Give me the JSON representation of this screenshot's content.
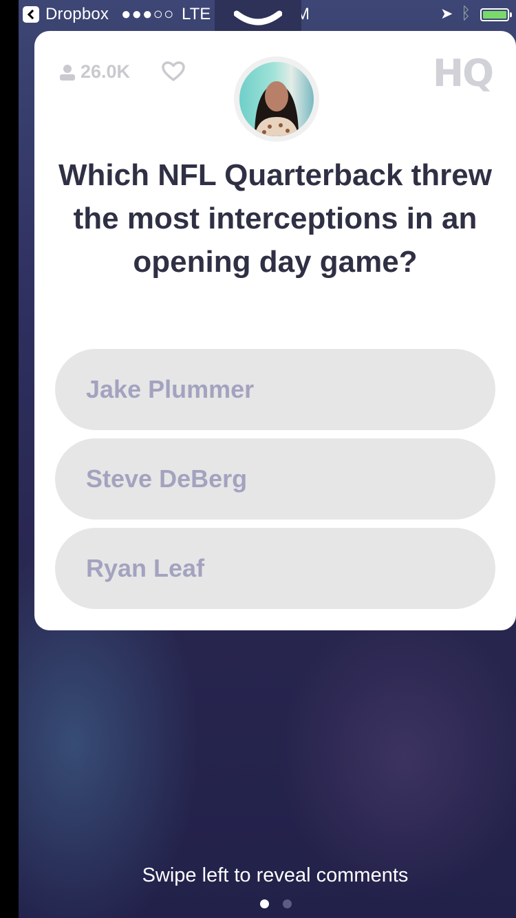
{
  "status_bar": {
    "back_app": "Dropbox",
    "signal": "●●●○○",
    "network": "LTE",
    "time_fragment": "M",
    "battery_level": 1.0
  },
  "game": {
    "viewer_count": "26.0K",
    "logo": "HQ",
    "question": "Which NFL Quarterback threw the most interceptions in an opening day game?",
    "answers": [
      {
        "label": "Jake Plummer"
      },
      {
        "label": "Steve DeBerg"
      },
      {
        "label": "Ryan Leaf"
      }
    ]
  },
  "footer": {
    "hint": "Swipe left to reveal comments",
    "page_dots": {
      "count": 2,
      "active": 1
    }
  },
  "colors": {
    "background": "#2e2f5e",
    "card": "#ffffff",
    "question_text": "#2f3044",
    "answer_bg": "#e6e6e6",
    "answer_text": "#a3a3c0",
    "battery": "#7ad96b"
  }
}
